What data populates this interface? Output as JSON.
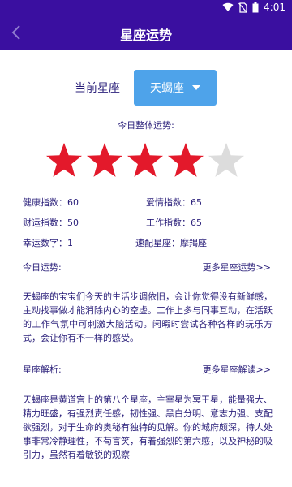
{
  "statusbar": {
    "time": "4:01"
  },
  "appbar": {
    "title": "星座运势"
  },
  "sign": {
    "label": "当前星座",
    "selected": "天蝎座"
  },
  "overall": {
    "title": "今日整体运势:",
    "rating": 4,
    "max": 5
  },
  "stats": {
    "health": "健康指数：60",
    "love": "爱情指数：65",
    "wealth": "财运指数：50",
    "work": "工作指数：65",
    "lucky": "幸运数字：1",
    "match": "速配星座：摩羯座"
  },
  "today": {
    "label": "今日运势:",
    "more": "更多星座运势>>",
    "text": "天蝎座的宝宝们今天的生活步调依旧，会让你觉得没有新鲜感，主动找事做才能消除内心的空虚。工作上多与同事互动，在活跃的工作气氛中可刺激大脑活动。闲暇时尝试各种各样的玩乐方式，会让你有不一样的感受。"
  },
  "analysis": {
    "label": "星座解析:",
    "more": "更多星座解读>>",
    "text": "天蝎座是黄道宫上的第八个星座，主宰星为冥王星，能量强大、精力旺盛，有强烈责任感，韧性强、黑白分明、意志力强、支配欲强烈，对于生命的奥秘有独特的见解。你的城府颇深，待人处事非常冷静理性，不苟言笑，有着强烈的第六感，以及神秘的吸引力，虽然有着敏锐的观察"
  },
  "colors": {
    "primary": "#3a0fa0",
    "button": "#4ea3ea",
    "star_on": "#e3192b",
    "star_off": "#dcdcdc",
    "text": "#2a1f7a"
  }
}
